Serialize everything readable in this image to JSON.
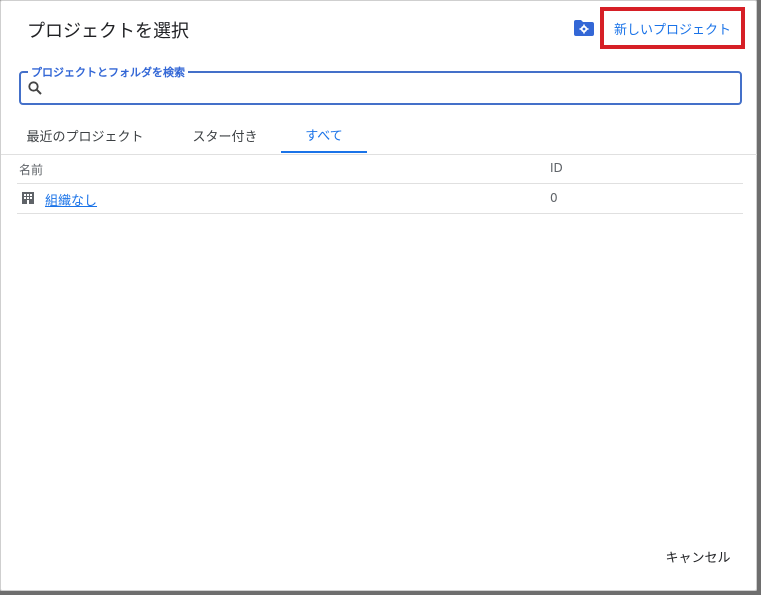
{
  "dialog": {
    "title": "プロジェクトを選択",
    "new_project_label": "新しいプロジェクト",
    "manage_icon": "folder-gear-icon"
  },
  "search": {
    "label": "プロジェクトとフォルダを検索",
    "value": "",
    "placeholder": ""
  },
  "tabs": [
    {
      "label": "最近のプロジェクト",
      "active": false
    },
    {
      "label": "スター付き",
      "active": false
    },
    {
      "label": "すべて",
      "active": true
    }
  ],
  "table": {
    "headers": {
      "name": "名前",
      "id": "ID"
    },
    "rows": [
      {
        "icon": "building-icon",
        "name": "組織なし",
        "id": "0"
      }
    ]
  },
  "footer": {
    "cancel_label": "キャンセル"
  },
  "colors": {
    "accent": "#1a73e8",
    "highlight": "#d61f26"
  }
}
